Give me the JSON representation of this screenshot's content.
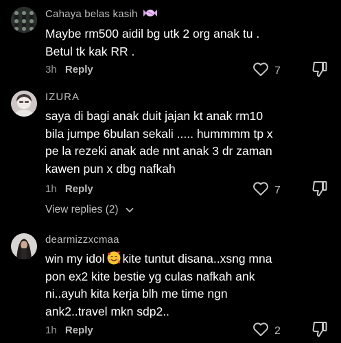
{
  "comments": [
    {
      "username": "Cahaya belas kasih",
      "username_icon": "candy-icon",
      "lines": [
        "Maybe rm500 aidil bg utk 2 org anak tu .",
        "Betul tk kak RR ."
      ],
      "time": "3h",
      "reply_label": "Reply",
      "likes": "7"
    },
    {
      "username": "IZURA",
      "lines": [
        "saya di bagi anak duit jajan kt anak rm10",
        "bila jumpe 6bulan sekali ..... hummmm tp x",
        "pe la rezeki anak ade nnt anak 3 dr zaman",
        "kawen pun x dbg nafkah"
      ],
      "time": "1h",
      "reply_label": "Reply",
      "likes": "7",
      "view_replies": "View replies (2)"
    },
    {
      "username": "dearmizzxcmaa",
      "line1_before": "win my idol",
      "line1_emoji": "smiling-face-with-hearts-icon",
      "line1_after": "kite tuntut disana..xsng mna",
      "lines_rest": [
        "pon ex2 kite bestie yg culas nafkah ank",
        "ni..ayuh kita kerja blh me time ngn",
        "ank2..travel mkn sdp2.."
      ],
      "time": "1h",
      "reply_label": "Reply",
      "likes": "2"
    }
  ],
  "colors": {
    "background": "#000000",
    "text": "#ffffff",
    "muted": "#9a9a9a"
  }
}
